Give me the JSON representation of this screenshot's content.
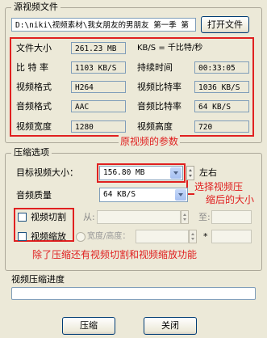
{
  "source": {
    "legend": "源视频文件",
    "path": "D:\\niki\\视频素材\\我女朋友的男朋友 第一季 第",
    "open_button": "打开文件",
    "file_size_label": "文件大小",
    "file_size_value": "261.23 MB",
    "unit_note": "KB/S = 千比特/秒",
    "bitrate_label": "比 特 率",
    "bitrate_value": "1103 KB/S",
    "duration_label": "持续时间",
    "duration_value": "00:33:05",
    "video_format_label": "视频格式",
    "video_format_value": "H264",
    "video_bitrate_label": "视频比特率",
    "video_bitrate_value": "1036 KB/S",
    "audio_format_label": "音频格式",
    "audio_format_value": "AAC",
    "audio_bitrate_label": "音频比特率",
    "audio_bitrate_value": "64 KB/S",
    "video_width_label": "视频宽度",
    "video_width_value": "1280",
    "video_height_label": "视频高度",
    "video_height_value": "720",
    "annotation": "原视频的参数"
  },
  "compress": {
    "legend": "压缩选项",
    "target_size_label": "目标视频大小：",
    "target_size_value": "156.80 MB",
    "approx": "左右",
    "annotation_line1": "选择视频压",
    "annotation_line2": "缩后的大小",
    "audio_quality_label": "音频质量",
    "audio_quality_value": "64 KB/S",
    "cut_label": "视频切割",
    "from_label": "从:",
    "to_label": "至:",
    "scale_label": "视频缩放",
    "width_height_label": "宽度/高度：",
    "times": "*",
    "annotation_bottom": "除了压缩还有视频切割和视频缩放功能"
  },
  "progress": {
    "label": "视频压缩进度",
    "value_fraction": 0
  },
  "footer": {
    "compress_button": "压缩",
    "close_button": "关闭"
  },
  "colors": {
    "annotation": "#e02020",
    "window_bg": "#ece9d8"
  }
}
